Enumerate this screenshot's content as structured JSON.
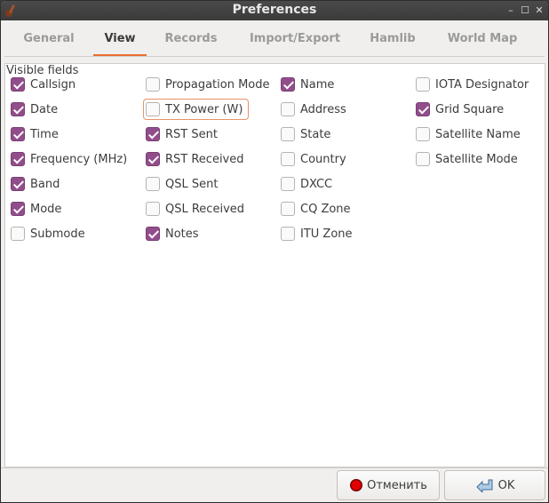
{
  "window": {
    "title": "Preferences"
  },
  "tabs": [
    {
      "label": "General",
      "active": false
    },
    {
      "label": "View",
      "active": true
    },
    {
      "label": "Records",
      "active": false
    },
    {
      "label": "Import/Export",
      "active": false
    },
    {
      "label": "Hamlib",
      "active": false
    },
    {
      "label": "World Map",
      "active": false
    }
  ],
  "visible_fields": {
    "title": "Visible fields",
    "columns": [
      [
        {
          "label": "Callsign",
          "checked": true
        },
        {
          "label": "Date",
          "checked": true
        },
        {
          "label": "Time",
          "checked": true
        },
        {
          "label": "Frequency (MHz)",
          "checked": true
        },
        {
          "label": "Band",
          "checked": true
        },
        {
          "label": "Mode",
          "checked": true
        },
        {
          "label": "Submode",
          "checked": false
        }
      ],
      [
        {
          "label": "Propagation Mode",
          "checked": false
        },
        {
          "label": "TX Power (W)",
          "checked": false,
          "focused": true
        },
        {
          "label": "RST Sent",
          "checked": true
        },
        {
          "label": "RST Received",
          "checked": true
        },
        {
          "label": "QSL Sent",
          "checked": false
        },
        {
          "label": "QSL Received",
          "checked": false
        },
        {
          "label": "Notes",
          "checked": true
        }
      ],
      [
        {
          "label": "Name",
          "checked": true
        },
        {
          "label": "Address",
          "checked": false
        },
        {
          "label": "State",
          "checked": false
        },
        {
          "label": "Country",
          "checked": false
        },
        {
          "label": "DXCC",
          "checked": false
        },
        {
          "label": "CQ Zone",
          "checked": false
        },
        {
          "label": "ITU Zone",
          "checked": false
        }
      ],
      [
        {
          "label": "IOTA Designator",
          "checked": false
        },
        {
          "label": "Grid Square",
          "checked": true
        },
        {
          "label": "Satellite Name",
          "checked": false
        },
        {
          "label": "Satellite Mode",
          "checked": false
        }
      ]
    ]
  },
  "buttons": {
    "cancel": {
      "label": "Отменить",
      "icon": "cancel-icon"
    },
    "ok": {
      "label": "OK",
      "icon": "ok-arrow-icon"
    }
  },
  "colors": {
    "accent": "#e86f2f",
    "checkbox_checked": "#924d8b",
    "titlebar": "#3b3b3b"
  }
}
